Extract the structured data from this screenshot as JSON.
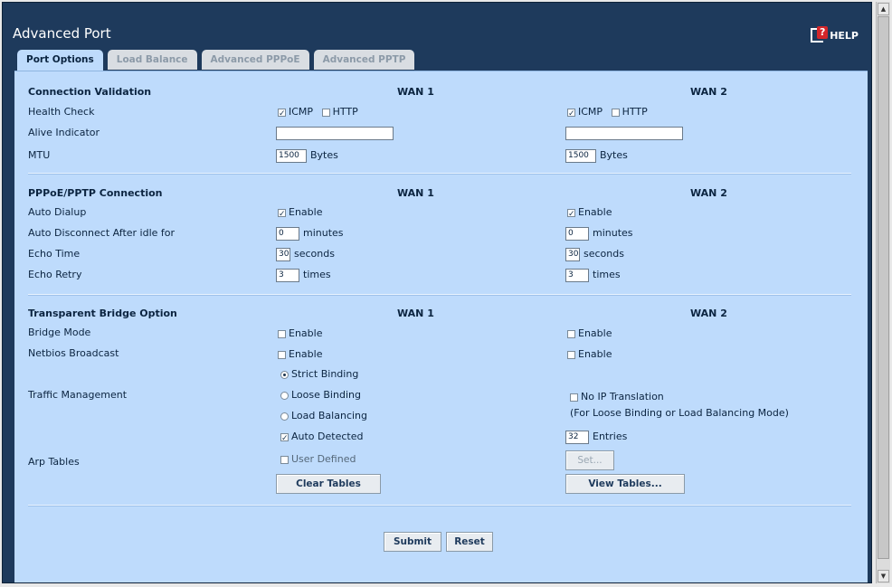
{
  "window": {
    "title": "Advanced Port",
    "help_label": "HELP"
  },
  "tabs": [
    {
      "label": "Port Options",
      "active": true
    },
    {
      "label": "Load Balance",
      "active": false
    },
    {
      "label": "Advanced PPPoE",
      "active": false
    },
    {
      "label": "Advanced PPTP",
      "active": false
    }
  ],
  "connection_validation": {
    "header": "Connection Validation",
    "wan1": "WAN 1",
    "wan2": "WAN 2",
    "health_check_label": "Health Check",
    "icmp_label": "ICMP",
    "http_label": "HTTP",
    "alive_indicator_label": "Alive Indicator",
    "alive_indicator_wan1": "",
    "alive_indicator_wan2": "",
    "mtu_label": "MTU",
    "mtu_wan1": "1500",
    "mtu_wan2": "1500",
    "bytes_unit": "Bytes",
    "icmp_wan1": true,
    "http_wan1": false,
    "icmp_wan2": true,
    "http_wan2": false
  },
  "pppoe_pptp": {
    "header": "PPPoE/PPTP Connection",
    "wan1": "WAN 1",
    "wan2": "WAN 2",
    "auto_dialup_label": "Auto Dialup",
    "enable_label": "Enable",
    "auto_disconnect_label": "Auto Disconnect After idle for",
    "auto_disconnect_wan1": "0",
    "auto_disconnect_wan2": "0",
    "minutes_unit": "minutes",
    "echo_time_label": "Echo Time",
    "echo_time_wan1": "30",
    "echo_time_wan2": "30",
    "seconds_unit": "seconds",
    "echo_retry_label": "Echo Retry",
    "echo_retry_wan1": "3",
    "echo_retry_wan2": "3",
    "times_unit": "times"
  },
  "transparent_bridge": {
    "header": "Transparent Bridge Option",
    "wan1": "WAN 1",
    "wan2": "WAN 2",
    "bridge_mode_label": "Bridge Mode",
    "netbios_label": "Netbios Broadcast",
    "enable_label": "Enable",
    "traffic_management_label": "Traffic Management",
    "strict_binding": "Strict Binding",
    "loose_binding": "Loose Binding",
    "load_balancing": "Load Balancing",
    "no_ip_translation": "No IP Translation",
    "no_ip_note": "(For Loose Binding or Load Balancing Mode)",
    "arp_tables_label": "Arp Tables",
    "auto_detected": "Auto Detected",
    "user_defined": "User Defined",
    "entries_value": "32",
    "entries_unit": "Entries",
    "set_button": "Set...",
    "clear_tables_button": "Clear Tables",
    "view_tables_button": "View Tables..."
  },
  "actions": {
    "submit": "Submit",
    "reset": "Reset"
  }
}
